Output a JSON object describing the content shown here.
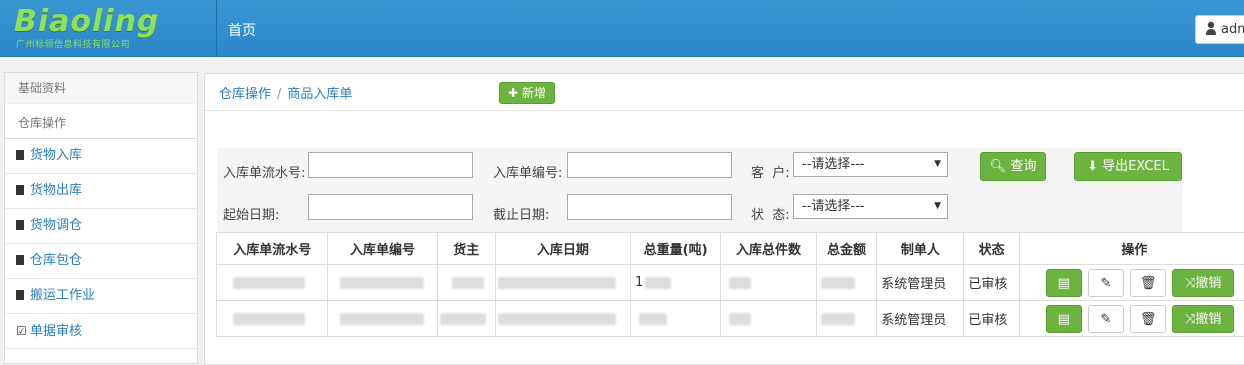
{
  "brand": {
    "logo_text": "Biaoling",
    "logo_subtitle": "广州标领信息科技有限公司"
  },
  "nav": {
    "home": "首页"
  },
  "user": {
    "name": "adm"
  },
  "sidebar": {
    "header": "基础资料",
    "group": "仓库操作",
    "items": [
      {
        "label": "货物入库",
        "icon": "doc-icon"
      },
      {
        "label": "货物出库",
        "icon": "doc-icon"
      },
      {
        "label": "货物调仓",
        "icon": "doc-icon"
      },
      {
        "label": "仓库包仓",
        "icon": "doc-icon"
      },
      {
        "label": "搬运工作业",
        "icon": "doc-icon"
      },
      {
        "label": "单据审核",
        "icon": "check-icon"
      }
    ]
  },
  "breadcrumb": {
    "root": "仓库操作",
    "sep": "/",
    "current": "商品入库单"
  },
  "toolbar": {
    "add_label": "新增"
  },
  "form": {
    "serial_label": "入库单流水号:",
    "serial_value": "",
    "code_label": "入库单编号:",
    "code_value": "",
    "customer_label": "客  户:",
    "customer_value": "--请选择---",
    "start_label": "起始日期:",
    "start_value": "",
    "end_label": "截止日期:",
    "end_value": "",
    "status_label": "状  态:",
    "status_value": "--请选择---",
    "query_label": "查询",
    "export_label": "导出EXCEL"
  },
  "table": {
    "headers": [
      "入库单流水号",
      "入库单编号",
      "货主",
      "入库日期",
      "总重量(吨)",
      "入库总件数",
      "总金额",
      "制单人",
      "状态",
      "操作"
    ],
    "rows": [
      {
        "weight_prefix": "1",
        "creator": "系统管理员",
        "status": "已审核"
      },
      {
        "weight_prefix": "",
        "creator": "系统管理员",
        "status": "已审核"
      }
    ],
    "revoke_label": "撤销"
  },
  "colors": {
    "topbar": "#2a87c8",
    "accent_green": "#6cb33f",
    "link_blue": "#2a7fc0"
  }
}
